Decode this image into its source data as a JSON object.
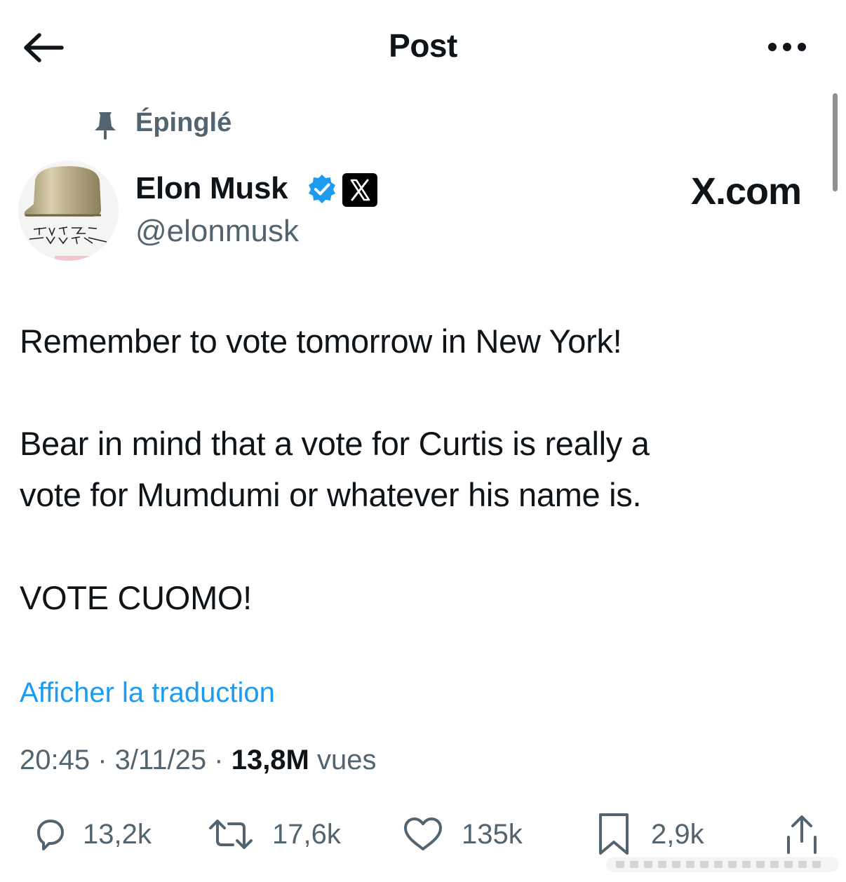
{
  "header": {
    "title": "Post",
    "back_icon": "arrow-left-icon",
    "more_icon": "more-horizontal-icon"
  },
  "pinned": {
    "icon": "pin-icon",
    "label": "Épinglé"
  },
  "author": {
    "name": "Elon Musk",
    "handle": "@elonmusk",
    "verified_color": "#1d9bf0",
    "affiliation_badge": "x-logo-badge",
    "affiliation": "X.com"
  },
  "post": {
    "lines": [
      "Remember to vote tomorrow in New York!",
      "Bear in mind that a vote for Curtis is really a",
      "vote for Mumdumi or whatever his name is.",
      "VOTE CUOMO!"
    ],
    "translate_link": "Afficher la traduction"
  },
  "meta": {
    "time": "20:45",
    "separator": " · ",
    "date": "3/11/25",
    "views_count": "13,8M",
    "views_label": " vues"
  },
  "actions": {
    "replies": "13,2k",
    "reposts": "17,6k",
    "likes": "135k",
    "bookmarks": "2,9k"
  },
  "colors": {
    "text": "#0f1419",
    "muted": "#536471",
    "link": "#1d9bf0"
  }
}
